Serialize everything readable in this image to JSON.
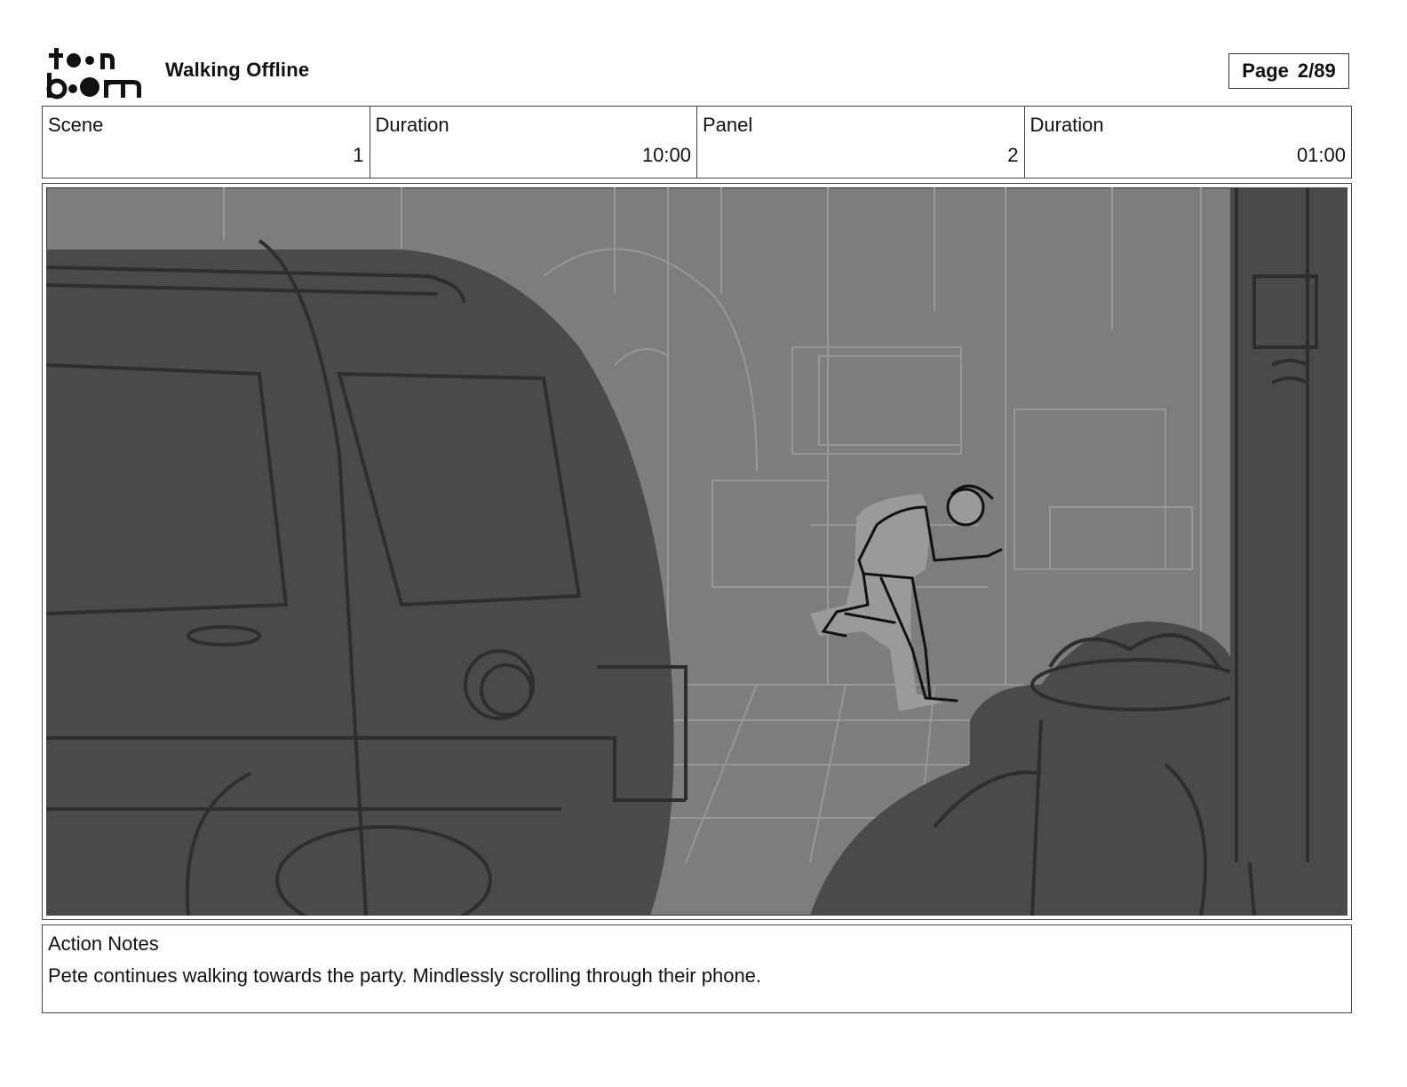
{
  "header": {
    "logo_text": "toonboom",
    "project_title": "Walking Offline",
    "page_label": "Page",
    "page_number": "2/89"
  },
  "info": {
    "scene_label": "Scene",
    "scene_value": "1",
    "scene_duration_label": "Duration",
    "scene_duration_value": "10:00",
    "panel_label": "Panel",
    "panel_value": "2",
    "panel_duration_label": "Duration",
    "panel_duration_value": "01:00"
  },
  "panel_image": {
    "icon": "storyboard-sketch-image",
    "colors": {
      "background": "#7d7d7d",
      "dark": "#4a4a4a",
      "line": "#2e2e2e",
      "light": "#9a9a9a"
    }
  },
  "notes": {
    "label": "Action Notes",
    "text": "Pete continues walking towards the party. Mindlessly scrolling through their phone."
  }
}
